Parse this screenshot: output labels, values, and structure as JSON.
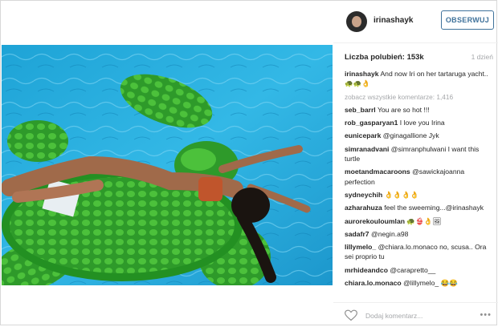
{
  "header": {
    "username": "irinashayk",
    "follow_label": "OBSERWUJ"
  },
  "meta": {
    "likes": "Liczba polubień: 153k",
    "time": "1 dzień"
  },
  "caption": {
    "user": "irinashayk",
    "text": "And now Iri on her tartaruga yacht.. 🐢🐢👌"
  },
  "load_more": "zobacz wszystkie komentarze: 1,416",
  "comments": [
    {
      "user": "seb_barrl",
      "text": "You are so hot !!!"
    },
    {
      "user": "rob_gasparyan1",
      "text": "I love you Irina"
    },
    {
      "user": "eunicepark",
      "text": "@ginagallione Jyk"
    },
    {
      "user": "simranadvani",
      "text": "@simranphulwani I want this turtle"
    },
    {
      "user": "moetandmacaroons",
      "text": "@sawickajoanna perfection"
    },
    {
      "user": "sydneychih",
      "text": "👌👌👌👌"
    },
    {
      "user": "azharahuza",
      "text": "feel the sweeming...@irinashayk"
    },
    {
      "user": "aurorekouloumlan",
      "text": "🐢👙👌🖼"
    },
    {
      "user": "sadafr7",
      "text": "@negin.a98"
    },
    {
      "user": "lillymelo_",
      "text": "@chiara.lo.monaco no, scusa.. Ora sei proprio tu"
    },
    {
      "user": "mrhideandco",
      "text": "@carapretto__"
    },
    {
      "user": "chiara.lo.monaco",
      "text": "@lillymelo_ 😂😂"
    }
  ],
  "footer": {
    "add_comment_placeholder": "Dodaj komentarz...",
    "more": "•••"
  },
  "colors": {
    "follow_blue": "#3f729b",
    "muted_text": "#a5a7aa",
    "pool": "#1fa8d8",
    "turtle_green": "#2e9a2a"
  }
}
